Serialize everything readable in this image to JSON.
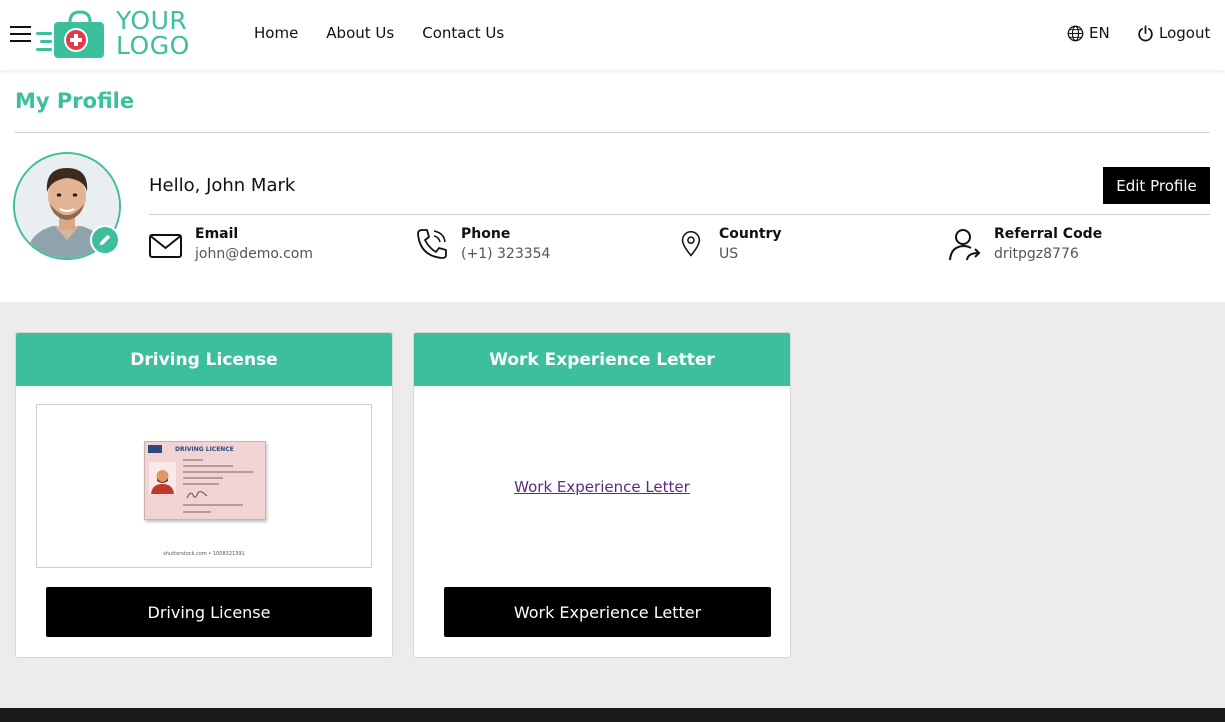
{
  "brand": {
    "logo_line1": "YOUR",
    "logo_line2": "LOGO",
    "accent_color": "#3cbf9d"
  },
  "header": {
    "menu_icon": "hamburger-icon",
    "nav": [
      "Home",
      "About Us",
      "Contact Us"
    ],
    "language": "EN",
    "language_icon": "globe-icon",
    "logout": "Logout",
    "logout_icon": "power-icon"
  },
  "profile": {
    "page_title": "My Profile",
    "greeting": "Hello, John Mark",
    "edit_button": "Edit Profile",
    "avatar_edit_icon": "pencil-icon",
    "info": [
      {
        "icon": "envelope-icon",
        "label": "Email",
        "value": "john@demo.com"
      },
      {
        "icon": "phone-icon",
        "label": "Phone",
        "value": "(+1) 323354"
      },
      {
        "icon": "location-pin-icon",
        "label": "Country",
        "value": "US"
      },
      {
        "icon": "user-share-icon",
        "label": "Referral Code",
        "value": "dritpgz8776"
      }
    ]
  },
  "documents": [
    {
      "title": "Driving License",
      "button": "Driving License",
      "preview": {
        "card_heading": "DRIVING LICENCE",
        "watermark": "shutterstock.com • 1008321391"
      }
    },
    {
      "title": "Work Experience Letter",
      "link": "Work Experience Letter",
      "button": "Work Experience Letter"
    }
  ]
}
